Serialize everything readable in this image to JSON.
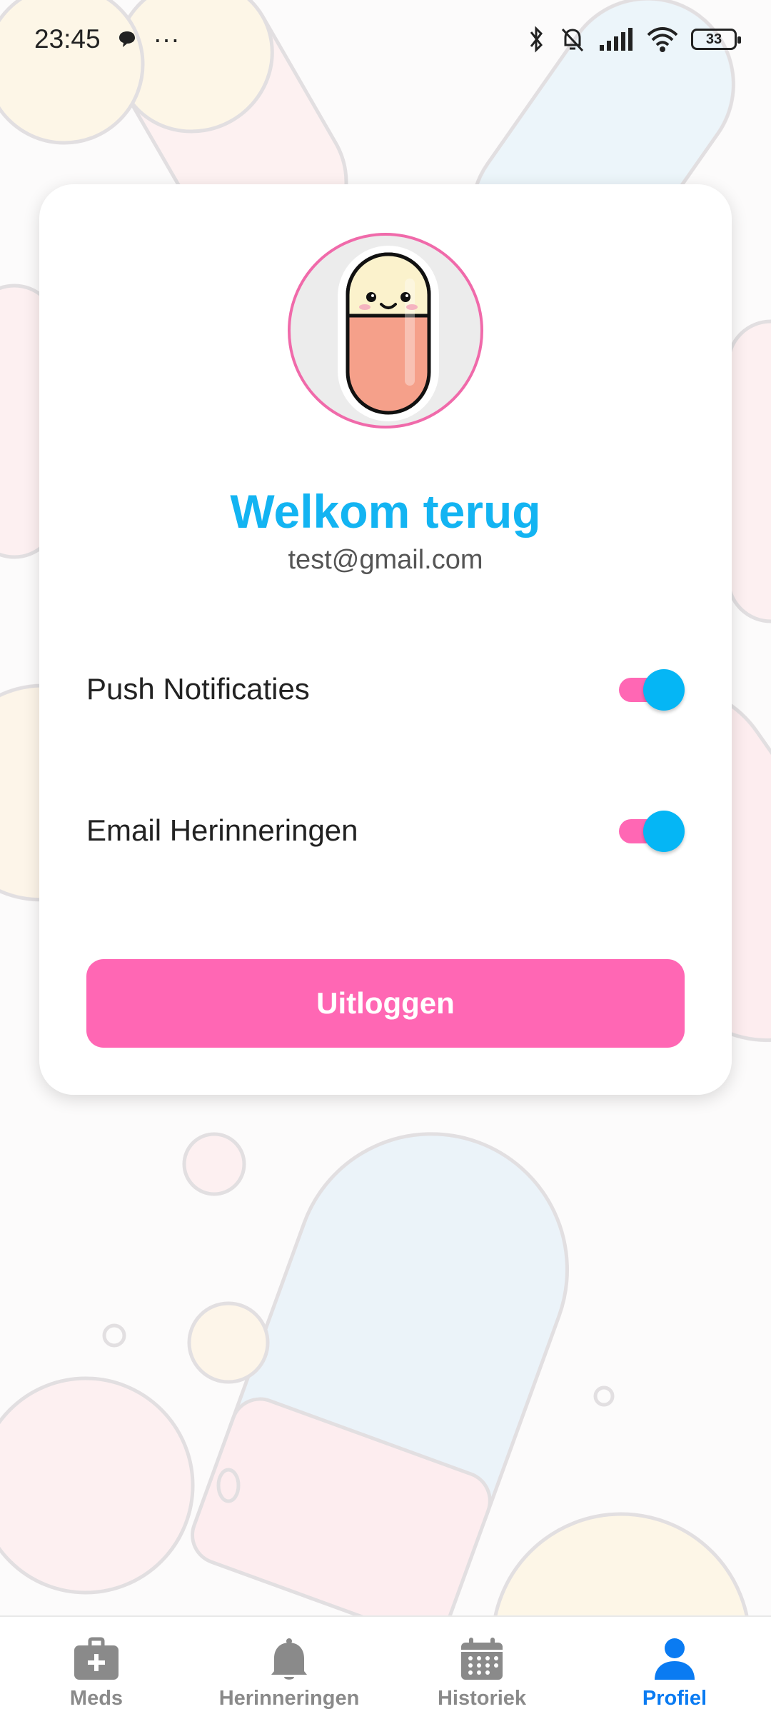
{
  "status_bar": {
    "time": "23:45",
    "more": "···",
    "battery": "33",
    "icons": [
      "chat-bubble-icon",
      "bluetooth-icon",
      "mute-bell-icon",
      "signal-icon",
      "wifi-icon",
      "battery-icon"
    ]
  },
  "profile": {
    "welcome_title": "Welkom terug",
    "email": "test@gmail.com",
    "avatar": "pill-mascot-icon"
  },
  "settings": [
    {
      "label": "Push Notificaties",
      "enabled": true
    },
    {
      "label": "Email Herinneringen",
      "enabled": true
    }
  ],
  "logout_label": "Uitloggen",
  "nav": {
    "items": [
      {
        "label": "Meds",
        "icon": "medical-kit-icon",
        "active": false
      },
      {
        "label": "Herinneringen",
        "icon": "bell-icon",
        "active": false
      },
      {
        "label": "Historiek",
        "icon": "calendar-icon",
        "active": false
      },
      {
        "label": "Profiel",
        "icon": "person-icon",
        "active": true
      }
    ]
  },
  "colors": {
    "accent_pink": "#ff67b4",
    "accent_blue": "#05b6f5",
    "title_blue": "#13b4f2",
    "nav_active": "#0a7bf2",
    "nav_inactive": "#8a8a8a"
  }
}
